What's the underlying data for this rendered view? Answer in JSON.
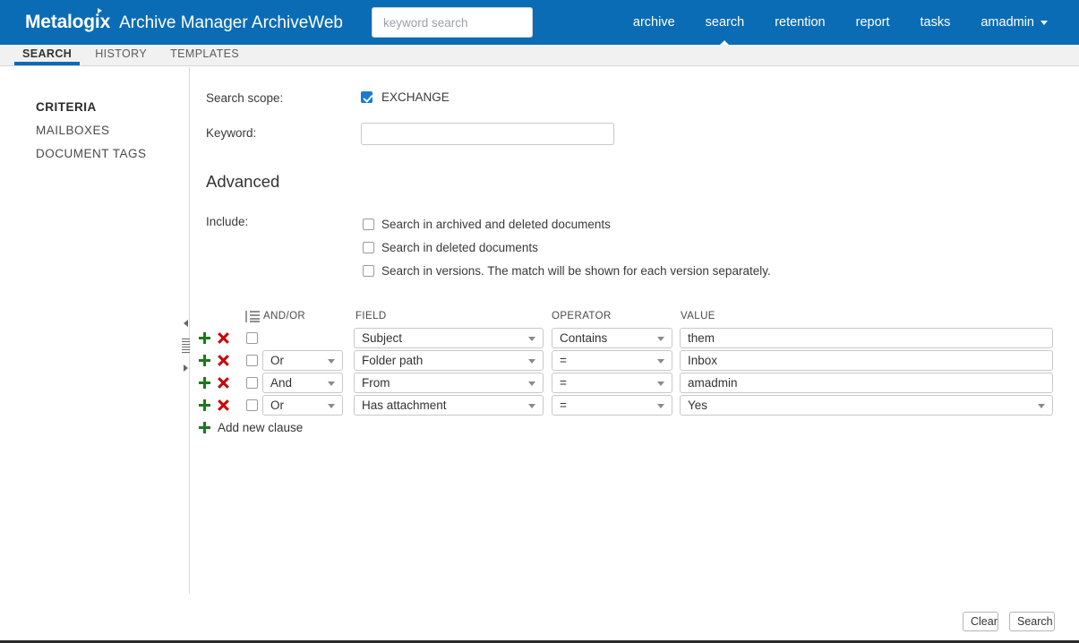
{
  "header": {
    "logo": "Metalogix",
    "app_title": "Archive Manager ArchiveWeb",
    "search_placeholder": "keyword search",
    "search_value": "",
    "nav": [
      {
        "label": "archive",
        "active": false
      },
      {
        "label": "search",
        "active": true
      },
      {
        "label": "retention",
        "active": false
      },
      {
        "label": "report",
        "active": false
      },
      {
        "label": "tasks",
        "active": false
      }
    ],
    "user": "amadmin",
    "brand_color": "#0a6cb4"
  },
  "tabs": [
    {
      "label": "SEARCH",
      "active": true
    },
    {
      "label": "HISTORY",
      "active": false
    },
    {
      "label": "TEMPLATES",
      "active": false
    }
  ],
  "sidebar": {
    "items": [
      {
        "label": "CRITERIA",
        "active": true
      },
      {
        "label": "MAILBOXES",
        "active": false
      },
      {
        "label": "DOCUMENT TAGS",
        "active": false
      }
    ]
  },
  "main": {
    "scope_label": "Search scope:",
    "scope_option": "EXCHANGE",
    "scope_checked": true,
    "keyword_label": "Keyword:",
    "keyword_value": "",
    "advanced_title": "Advanced",
    "include_label": "Include:",
    "include_options": [
      {
        "label": "Search in archived and deleted documents",
        "checked": false
      },
      {
        "label": "Search in deleted documents",
        "checked": false
      },
      {
        "label": "Search in versions. The match will be shown for each version separately.",
        "checked": false
      }
    ],
    "columns": {
      "andor": "AND/OR",
      "field": "FIELD",
      "operator": "OPERATOR",
      "value": "VALUE"
    },
    "clauses": [
      {
        "selected": false,
        "andor": "",
        "field": "Subject",
        "operator": "Contains",
        "value": "them",
        "value_is_select": false
      },
      {
        "selected": false,
        "andor": "Or",
        "field": "Folder path",
        "operator": "=",
        "value": "Inbox",
        "value_is_select": false
      },
      {
        "selected": false,
        "andor": "And",
        "field": "From",
        "operator": "=",
        "value": "amadmin",
        "value_is_select": false
      },
      {
        "selected": false,
        "andor": "Or",
        "field": "Has attachment",
        "operator": "=",
        "value": "Yes",
        "value_is_select": true
      }
    ],
    "add_clause_label": "Add new clause"
  },
  "footer": {
    "clear_label": "Clear",
    "search_label": "Search"
  }
}
